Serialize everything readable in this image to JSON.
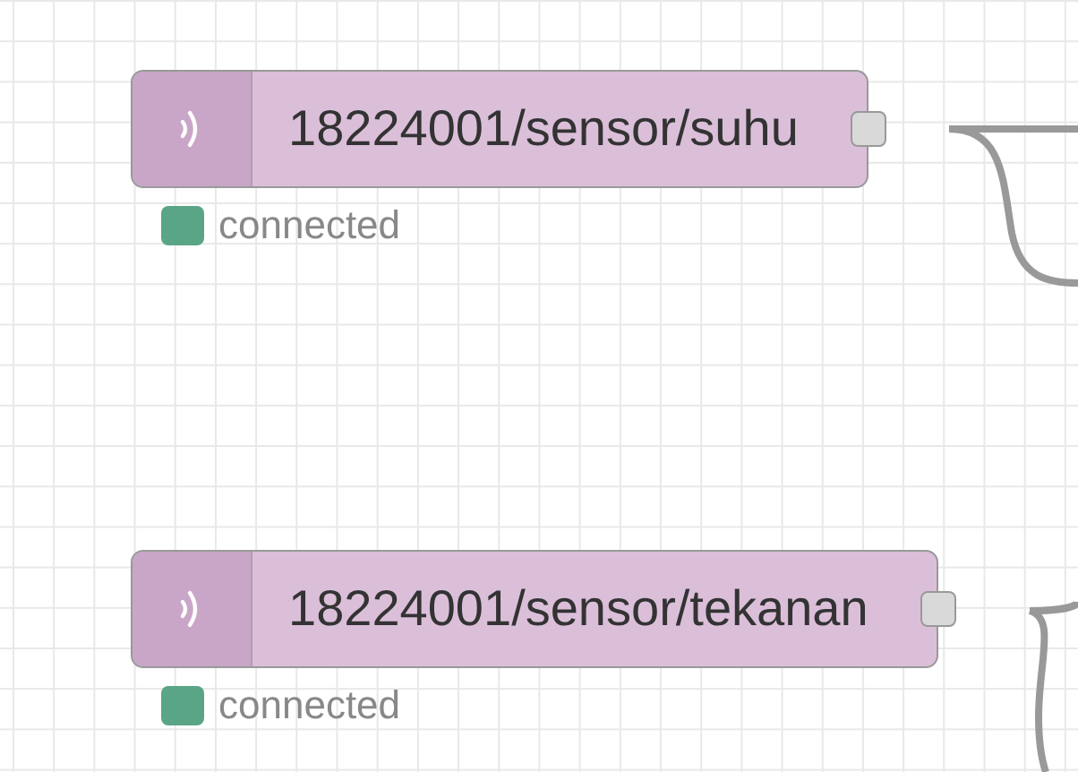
{
  "nodes": [
    {
      "label": "18224001/sensor/suhu",
      "status": {
        "text": "connected",
        "color": "#5aa586"
      }
    },
    {
      "label": "18224001/sensor/tekanan",
      "status": {
        "text": "connected",
        "color": "#5aa586"
      }
    }
  ]
}
